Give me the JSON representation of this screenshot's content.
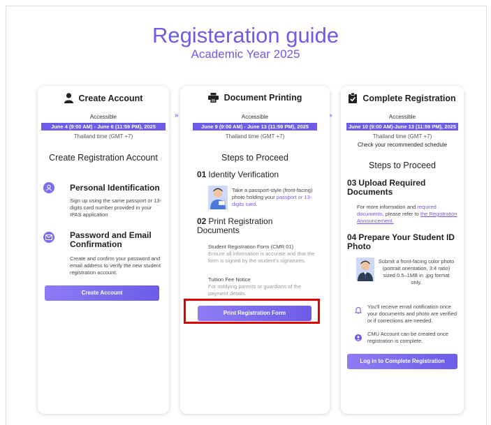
{
  "page": {
    "title": "Registeration guide",
    "subtitle": "Academic Year 2025",
    "step_arrow": "»"
  },
  "colors": {
    "accent": "#6c5ce7",
    "highlight": "#e00000"
  },
  "create_account": {
    "icon": "person-icon",
    "title": "Create Account",
    "status": "Accessible",
    "date": "June 4 (9:00 AM) - June 6 (11:59 PM), 2025",
    "timezone": "Thailand time (GMT +7)",
    "heading": "Create Registration Account",
    "items": [
      {
        "icon": "user-icon",
        "title": "Personal Identification",
        "text": "Sign up using the same passport or 13-digits card number provided in your IPAS application"
      },
      {
        "icon": "email-icon",
        "title": "Password and Email Confirmation",
        "text": "Create and confirm your password and email address to verify the new student registration account."
      }
    ],
    "button": "Create Account"
  },
  "document_printing": {
    "icon": "printer-icon",
    "title": "Document Printing",
    "status": "Accessible",
    "date": "June 9 (9:00 AM) - June 13 (11:59 PM), 2025",
    "timezone": "Thailand time (GMT +7)",
    "heading": "Steps to Proceed",
    "step1": {
      "num": "01",
      "title": "Identity Verification",
      "text": "Take a passport-style (front-facing) photo holding your ",
      "link": "passport or 13-digits card."
    },
    "step2": {
      "num": "02",
      "title": "Print Registration Documents",
      "doc1_title": "Student Registration Form (CMR 01)",
      "doc1_text": "Ensure all information is accurate and that the form is signed by the student's signatures.",
      "doc2_title": "Tuition Fee Notice",
      "doc2_text": "For notifying parents or guardians of the payment details."
    },
    "button": "Print Registration Form"
  },
  "complete_registration": {
    "icon": "clipboard-check-icon",
    "title": "Complete Registration",
    "status": "Accessible",
    "date": "June 10 (9:00 AM)-June 13 (11:59 PM), 2025",
    "timezone": "Thailand time (GMT +7)",
    "note": "Check your recommended schedule",
    "heading": "Steps to Proceed",
    "step3": {
      "num": "03",
      "title": "Upload Required Documents",
      "text_a": "For more information and ",
      "link_a": "required documents",
      "text_b": ", please refer to ",
      "link_b": "the Registration Announcement."
    },
    "step4": {
      "num": "04",
      "title": "Prepare Your Student ID Photo",
      "text": "Submit a front-facing color photo (portrait orientation, 3:4 ratio) sized 0.5–1MB in .jpg format only."
    },
    "info1": "You'll receive email notification once your documents and photo are verified or if corrections are needed.",
    "info2": "CMU Account can be created once registration is complete.",
    "button": "Log in to Complete Registration"
  }
}
